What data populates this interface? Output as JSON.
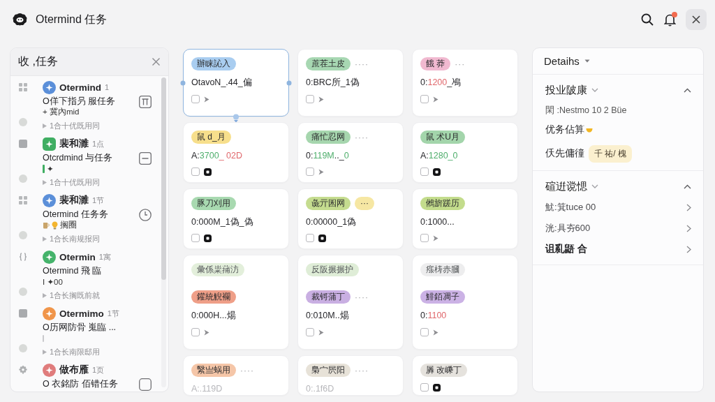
{
  "app": {
    "title": "Otermind 任务"
  },
  "toolbar": {
    "has_unread": true
  },
  "inbox": {
    "title": "收 ,任务",
    "items": [
      {
        "name": "Otermind",
        "count": "1",
        "color": "#5b8fd9",
        "title": "O佯下指叧 服任务",
        "subtitle": "+ 冀內mid",
        "meta": "1合十优既用同"
      },
      {
        "name": "裴和濉",
        "count": "1点",
        "color": "#3fae62",
        "title": "Otcrdmind 与任务",
        "subtitle": "✦",
        "meta": "1合十优既用同"
      },
      {
        "name": "裴和濉",
        "count": "1节",
        "color": "#5b8fd9",
        "title": "Otermind 任务务",
        "subtitle": "搁圈",
        "meta": "1合长南规报同"
      },
      {
        "name": "Otermin",
        "count": "1寓",
        "color": "#45b36b",
        "title": "Otermind 飛 臨",
        "subtitle": "I ✦00",
        "meta": "1合长搁既前就"
      },
      {
        "name": "Otermimo",
        "count": "1节",
        "color": "#f0954a",
        "title": "O历网防骨 嵬臨 ...",
        "meta": "1合长南限邸用"
      },
      {
        "name": "做布雁",
        "count": "1页",
        "color": "#e07c7c",
        "title": "O 衣銘防 佰错任务"
      }
    ]
  },
  "board": {
    "cards": [
      {
        "selected": true,
        "tags": [
          {
            "label": "辦睐訫入",
            "color": "#a9cdf0"
          }
        ],
        "value": [
          {
            "text": "OtavoN_.44_偏",
            "kind": "plain"
          }
        ],
        "checked": false
      },
      {
        "selected": false,
        "tags": [
          {
            "label": "蔗茬土皮",
            "color": "#a7d7b2"
          }
        ],
        "more": "····",
        "value": [
          {
            "text": "0:BRC所_1偽",
            "kind": "plain"
          }
        ],
        "checked": false
      },
      {
        "selected": false,
        "tags": [
          {
            "label": "餓 莽",
            "color": "#f1b9d0"
          }
        ],
        "more": "···",
        "value": [
          {
            "text": "0:",
            "kind": "plain"
          },
          {
            "text": "1200",
            "kind": "negative"
          },
          {
            "text": "_鳰",
            "kind": "plain"
          }
        ],
        "checked": false
      },
      {
        "selected": false,
        "tags": [
          {
            "label": "鼠 d_月",
            "color": "#f7df8c"
          }
        ],
        "value": [
          {
            "text": "A:",
            "kind": "plain"
          },
          {
            "text": "3700",
            "kind": "positive"
          },
          {
            "text": "_ 02D",
            "kind": "negative"
          }
        ],
        "checked": false
      },
      {
        "selected": false,
        "tags": [
          {
            "label": "痛忙忍网",
            "color": "#a6d6ae"
          }
        ],
        "more": "····",
        "value": [
          {
            "text": "0:",
            "kind": "plain"
          },
          {
            "text": "119M",
            "kind": "positive"
          },
          {
            "text": ".._",
            "kind": "plain"
          },
          {
            "text": "0",
            "kind": "positive"
          }
        ],
        "checked": false
      },
      {
        "selected": false,
        "tags": [
          {
            "label": "鼠 术U月",
            "color": "#a3d5ab"
          }
        ],
        "value": [
          {
            "text": "A:",
            "kind": "plain"
          },
          {
            "text": "1280_0",
            "kind": "positive"
          }
        ],
        "checked": false
      },
      {
        "selected": false,
        "tags": [
          {
            "label": "豚刀刈用",
            "color": "#a8d9b0"
          }
        ],
        "value": [
          {
            "text": "0:000M_1偽_偽",
            "kind": "plain"
          }
        ],
        "checked": false
      },
      {
        "selected": false,
        "tags": [
          {
            "label": "彘亓囷网",
            "color": "#c5dc8f"
          },
          {
            "label": "···",
            "color": "#f6e7a3"
          }
        ],
        "value": [
          {
            "text": "0:00000_1偽",
            "kind": "plain"
          }
        ],
        "checked": false
      },
      {
        "selected": false,
        "tags": [
          {
            "label": "鵂旂蹉历",
            "color": "#c3dc8c"
          }
        ],
        "value": [
          {
            "text": "0:1000...",
            "kind": "plain"
          }
        ],
        "checked": false
      },
      {
        "selected": false,
        "group": {
          "label": "彙係粜蒱汸",
          "color": "#e3efdb"
        },
        "tags": [
          {
            "label": "鑵統觬襴",
            "color": "#ef9f88"
          }
        ],
        "value": [
          {
            "text": "0:000H...煬",
            "kind": "plain"
          }
        ],
        "checked": false
      },
      {
        "selected": false,
        "group": {
          "label": "反阪搌搌护",
          "color": "#dfedd7"
        },
        "tags": [
          {
            "label": "裁锊蒲丁",
            "color": "#c9afe2"
          }
        ],
        "more": "····",
        "value": [
          {
            "text": "0:010M..煬",
            "kind": "plain"
          }
        ],
        "checked": false
      },
      {
        "selected": false,
        "group": {
          "label": "瘬梼赤膕",
          "color": "#ededee"
        },
        "tags": [
          {
            "label": "鯡銆凋子",
            "color": "#cbb2e5"
          }
        ],
        "value": [
          {
            "text": "0:",
            "kind": "plain"
          },
          {
            "text": "1100",
            "kind": "negative"
          }
        ],
        "checked": false
      },
      {
        "selected": false,
        "tags": [
          {
            "label": "繄亗蜗用",
            "color": "#f5c6a8"
          }
        ],
        "more": "····",
        "value": [
          {
            "text": "A:.119D",
            "kind": "muted"
          }
        ]
      },
      {
        "selected": false,
        "tags": [
          {
            "label": "梟宀屄阳",
            "color": "#e7e2d8"
          }
        ],
        "more": "····",
        "value": [
          {
            "text": "0:.1f6D",
            "kind": "muted"
          }
        ]
      },
      {
        "selected": false,
        "tags": [
          {
            "label": "羼 改嵊丁",
            "color": "#e5e2dd"
          }
        ],
        "checked": false
      }
    ]
  },
  "details": {
    "title": "Detaihs",
    "sections": [
      {
        "title": "投业陂康",
        "expanded": true,
        "rows": [
          {
            "kind": "meta",
            "label": "閑 :Nestmo 10 2 Büe"
          },
          {
            "kind": "note",
            "label": "优务佔算"
          },
          {
            "kind": "tag",
            "label": "仸先傭徸",
            "tag": "千 祐/ 槐"
          }
        ]
      },
      {
        "title": "碹逬谠愢",
        "expanded": true,
        "rows": [
          {
            "kind": "link",
            "label": "魷:箕tuce 00",
            "strong": false
          },
          {
            "kind": "link",
            "label": "洸:具夯600",
            "strong": false
          },
          {
            "kind": "link",
            "label": "诅乿鼯 合",
            "strong": true
          }
        ]
      }
    ]
  }
}
